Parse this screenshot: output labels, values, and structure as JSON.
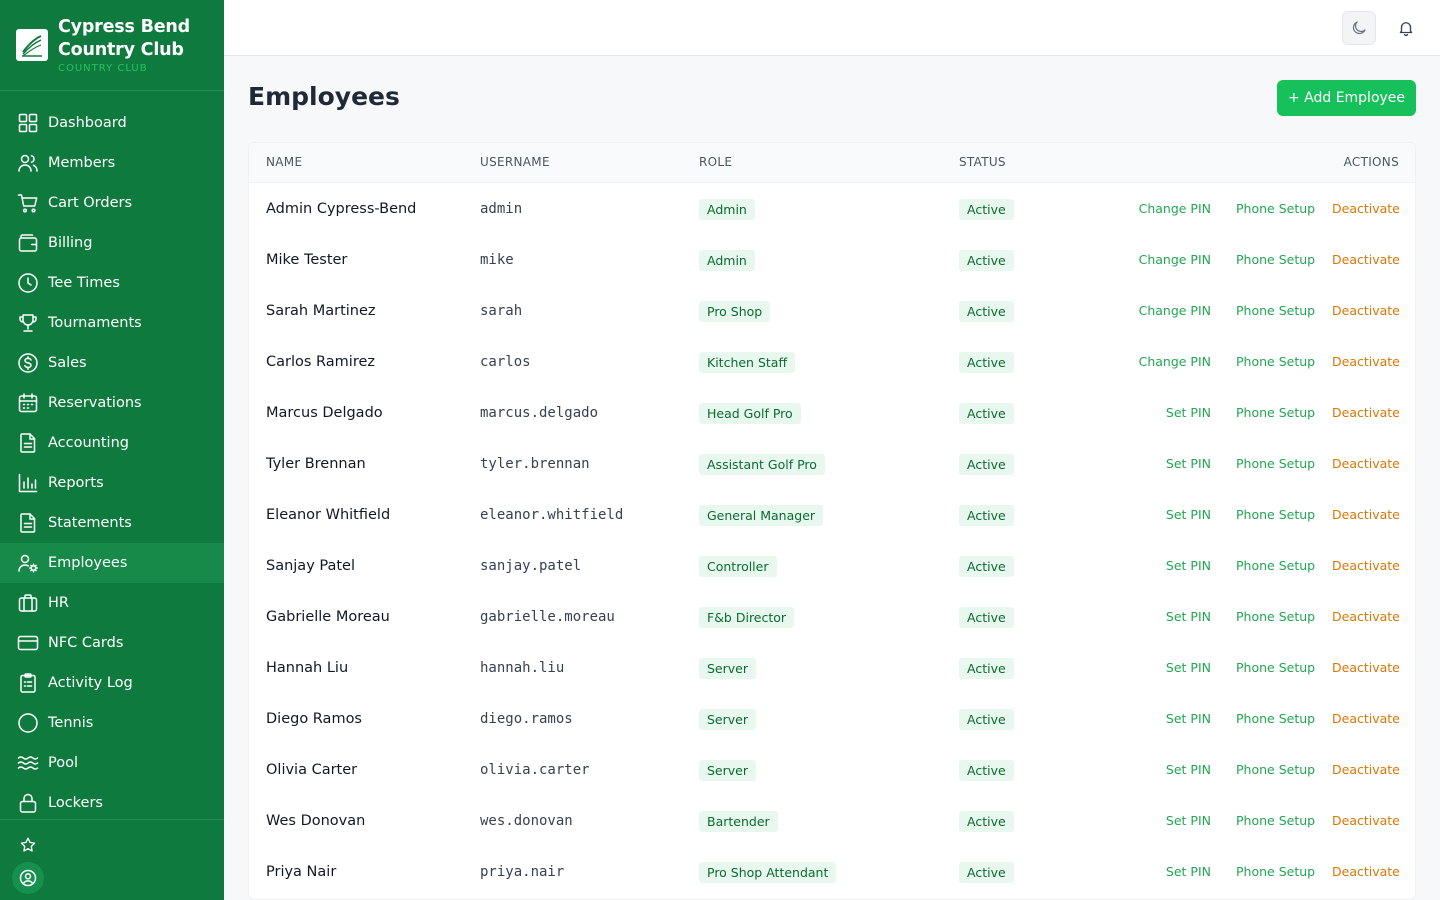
{
  "brand": {
    "name_line1": "Cypress Bend",
    "name_line2": "Country Club",
    "subtitle": "COUNTRY CLUB"
  },
  "nav": [
    {
      "label": "Dashboard",
      "icon": "dashboard-icon",
      "active": false
    },
    {
      "label": "Members",
      "icon": "users-icon",
      "active": false
    },
    {
      "label": "Cart Orders",
      "icon": "cart-icon",
      "active": false
    },
    {
      "label": "Billing",
      "icon": "wallet-icon",
      "active": false
    },
    {
      "label": "Tee Times",
      "icon": "clock-icon",
      "active": false
    },
    {
      "label": "Tournaments",
      "icon": "trophy-icon",
      "active": false
    },
    {
      "label": "Sales",
      "icon": "dollar-icon",
      "active": false
    },
    {
      "label": "Reservations",
      "icon": "calendar-icon",
      "active": false
    },
    {
      "label": "Accounting",
      "icon": "document-icon",
      "active": false
    },
    {
      "label": "Reports",
      "icon": "bar-chart-icon",
      "active": false
    },
    {
      "label": "Statements",
      "icon": "document-icon",
      "active": false
    },
    {
      "label": "Employees",
      "icon": "user-gear-icon",
      "active": true
    },
    {
      "label": "HR",
      "icon": "briefcase-icon",
      "active": false
    },
    {
      "label": "NFC Cards",
      "icon": "credit-card-icon",
      "active": false
    },
    {
      "label": "Activity Log",
      "icon": "clipboard-icon",
      "active": false
    },
    {
      "label": "Tennis",
      "icon": "circle-icon",
      "active": false
    },
    {
      "label": "Pool",
      "icon": "waves-icon",
      "active": false
    },
    {
      "label": "Lockers",
      "icon": "lock-icon",
      "active": false
    }
  ],
  "page": {
    "title": "Employees",
    "add_button": "+ Add Employee"
  },
  "table": {
    "headers": {
      "name": "NAME",
      "username": "USERNAME",
      "role": "ROLE",
      "status": "STATUS",
      "actions": "ACTIONS"
    },
    "rows": [
      {
        "name": "Admin Cypress-Bend",
        "username": "admin",
        "role": "Admin",
        "status": "Active",
        "pin_action": "Change PIN",
        "phone_action": "Phone Setup",
        "deactivate_action": "Deactivate"
      },
      {
        "name": "Mike Tester",
        "username": "mike",
        "role": "Admin",
        "status": "Active",
        "pin_action": "Change PIN",
        "phone_action": "Phone Setup",
        "deactivate_action": "Deactivate"
      },
      {
        "name": "Sarah Martinez",
        "username": "sarah",
        "role": "Pro Shop",
        "status": "Active",
        "pin_action": "Change PIN",
        "phone_action": "Phone Setup",
        "deactivate_action": "Deactivate"
      },
      {
        "name": "Carlos Ramirez",
        "username": "carlos",
        "role": "Kitchen Staff",
        "status": "Active",
        "pin_action": "Change PIN",
        "phone_action": "Phone Setup",
        "deactivate_action": "Deactivate"
      },
      {
        "name": "Marcus Delgado",
        "username": "marcus.delgado",
        "role": "Head Golf Pro",
        "status": "Active",
        "pin_action": "Set PIN",
        "phone_action": "Phone Setup",
        "deactivate_action": "Deactivate"
      },
      {
        "name": "Tyler Brennan",
        "username": "tyler.brennan",
        "role": "Assistant Golf Pro",
        "status": "Active",
        "pin_action": "Set PIN",
        "phone_action": "Phone Setup",
        "deactivate_action": "Deactivate"
      },
      {
        "name": "Eleanor Whitfield",
        "username": "eleanor.whitfield",
        "role": "General Manager",
        "status": "Active",
        "pin_action": "Set PIN",
        "phone_action": "Phone Setup",
        "deactivate_action": "Deactivate"
      },
      {
        "name": "Sanjay Patel",
        "username": "sanjay.patel",
        "role": "Controller",
        "status": "Active",
        "pin_action": "Set PIN",
        "phone_action": "Phone Setup",
        "deactivate_action": "Deactivate"
      },
      {
        "name": "Gabrielle Moreau",
        "username": "gabrielle.moreau",
        "role": "F&b Director",
        "status": "Active",
        "pin_action": "Set PIN",
        "phone_action": "Phone Setup",
        "deactivate_action": "Deactivate"
      },
      {
        "name": "Hannah Liu",
        "username": "hannah.liu",
        "role": "Server",
        "status": "Active",
        "pin_action": "Set PIN",
        "phone_action": "Phone Setup",
        "deactivate_action": "Deactivate"
      },
      {
        "name": "Diego Ramos",
        "username": "diego.ramos",
        "role": "Server",
        "status": "Active",
        "pin_action": "Set PIN",
        "phone_action": "Phone Setup",
        "deactivate_action": "Deactivate"
      },
      {
        "name": "Olivia Carter",
        "username": "olivia.carter",
        "role": "Server",
        "status": "Active",
        "pin_action": "Set PIN",
        "phone_action": "Phone Setup",
        "deactivate_action": "Deactivate"
      },
      {
        "name": "Wes Donovan",
        "username": "wes.donovan",
        "role": "Bartender",
        "status": "Active",
        "pin_action": "Set PIN",
        "phone_action": "Phone Setup",
        "deactivate_action": "Deactivate"
      },
      {
        "name": "Priya Nair",
        "username": "priya.nair",
        "role": "Pro Shop Attendant",
        "status": "Active",
        "pin_action": "Set PIN",
        "phone_action": "Phone Setup",
        "deactivate_action": "Deactivate"
      }
    ]
  },
  "colors": {
    "sidebar": "#0f7a3e",
    "accent": "#16c05a",
    "action_link": "#22a653",
    "deactivate": "#d97706"
  }
}
